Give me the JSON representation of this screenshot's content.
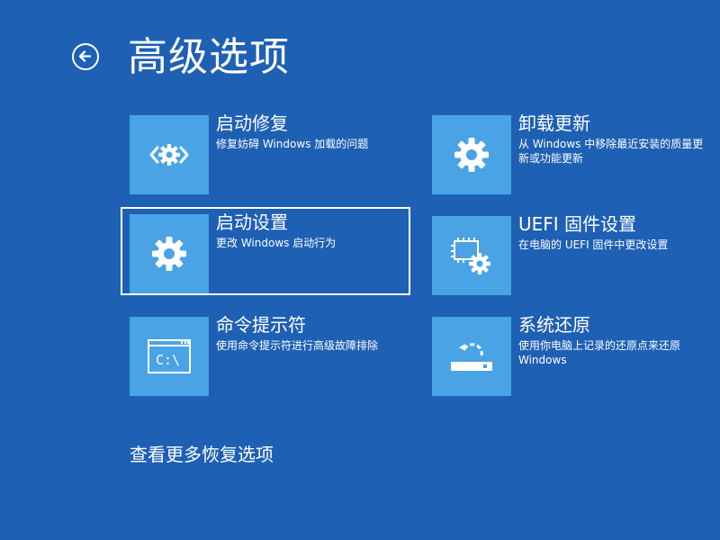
{
  "page": {
    "title": "高级选项",
    "more_link": "查看更多恢复选项"
  },
  "options": [
    {
      "id": "startup-repair",
      "label": "启动修复",
      "desc": "修复妨碍 Windows 加载的问题",
      "icon": "startup-repair-icon"
    },
    {
      "id": "uninstall-updates",
      "label": "卸载更新",
      "desc": "从 Windows 中移除最近安装的质量更新或功能更新",
      "icon": "gear-icon"
    },
    {
      "id": "startup-settings",
      "label": "启动设置",
      "desc": "更改 Windows 启动行为",
      "icon": "gear-icon",
      "selected": true
    },
    {
      "id": "uefi-firmware",
      "label": "UEFI 固件设置",
      "desc": "在电脑的 UEFI 固件中更改设置",
      "icon": "firmware-gear-icon"
    },
    {
      "id": "command-prompt",
      "label": "命令提示符",
      "desc": "使用命令提示符进行高级故障排除",
      "icon": "command-prompt-icon",
      "icon_text": "C:\\"
    },
    {
      "id": "system-restore",
      "label": "系统还原",
      "desc": "使用你电脑上记录的还原点来还原 Windows",
      "icon": "system-restore-icon"
    }
  ],
  "colors": {
    "background": "#1e60b4",
    "tile": "#4aa3e4",
    "text": "#ffffff"
  }
}
